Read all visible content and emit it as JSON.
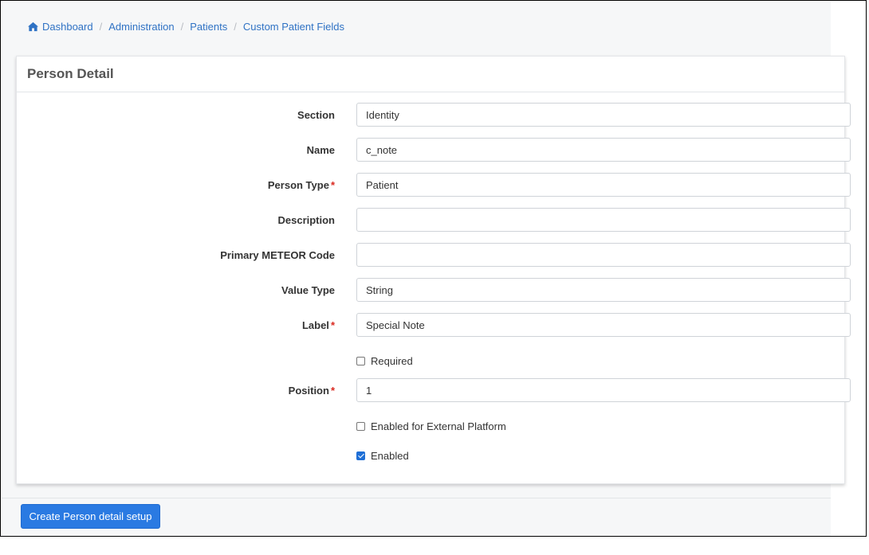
{
  "breadcrumb": {
    "items": [
      "Dashboard",
      "Administration",
      "Patients",
      "Custom Patient Fields"
    ],
    "separator": "/"
  },
  "card": {
    "title": "Person Detail"
  },
  "form": {
    "section": {
      "label": "Section",
      "value": "Identity"
    },
    "name": {
      "label": "Name",
      "value": "c_note"
    },
    "person_type": {
      "label": "Person Type",
      "value": "Patient",
      "required_mark": "*"
    },
    "description": {
      "label": "Description",
      "value": ""
    },
    "primary_meteor_code": {
      "label": "Primary METEOR Code",
      "value": ""
    },
    "value_type": {
      "label": "Value Type",
      "value": "String"
    },
    "label": {
      "label": "Label",
      "value": "Special Note",
      "required_mark": "*"
    },
    "required": {
      "label": "Required",
      "checked": false
    },
    "position": {
      "label": "Position",
      "value": "1",
      "required_mark": "*"
    },
    "external_platform": {
      "label": "Enabled for External Platform",
      "checked": false
    },
    "enabled": {
      "label": "Enabled",
      "checked": true
    }
  },
  "actions": {
    "create_label": "Create Person detail setup"
  },
  "colors": {
    "link": "#2f72c4",
    "primary": "#2a7ae2",
    "required": "#d9281f"
  },
  "icons": {
    "home": "home-icon"
  }
}
